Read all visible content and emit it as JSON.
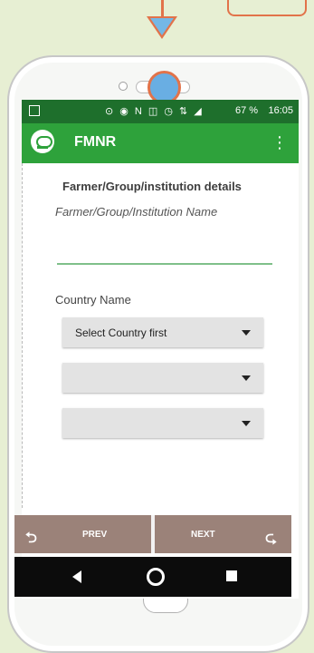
{
  "colors": {
    "background": "#e7efd3",
    "status_bar": "#1e6f2c",
    "app_bar": "#2ea23b",
    "nav_button": "#9b8279",
    "accent_line": "#7fc08a",
    "annotation": "#e2734a",
    "highlight": "#69aee3"
  },
  "status_bar": {
    "battery": "67 %",
    "time": "16:05"
  },
  "app_bar": {
    "title": "FMNR",
    "menu_icon": "more-vert-icon"
  },
  "form": {
    "heading": "Farmer/Group/institution details",
    "name_label": "Farmer/Group/Institution Name",
    "country_label": "Country Name",
    "country_select": "Select Country first",
    "select_2": "",
    "select_3": ""
  },
  "footer": {
    "prev": "PREV",
    "next": "NEXT"
  }
}
